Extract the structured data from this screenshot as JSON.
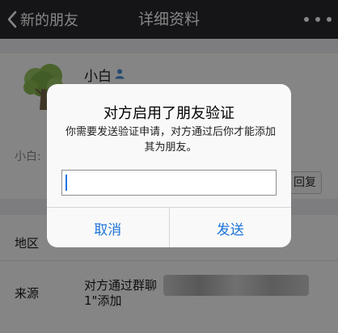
{
  "nav": {
    "back_label": "新的朋友",
    "title": "详细资料",
    "back_icon": "chevron-left-icon",
    "more_icon": "more-icon"
  },
  "profile": {
    "nickname": "小白",
    "gender_icon": "person-icon",
    "avatar_icon": "tree-icon",
    "remark": "小白: ",
    "reply_label": "回复"
  },
  "info": {
    "region_label": "地区",
    "source_label": "来源",
    "source_value_line1": "对方通过群聊",
    "source_value_line2": "1\"添加"
  },
  "dialog": {
    "title": "对方启用了朋友验证",
    "message": "你需要发送验证申请，对方通过后你才能添加其为朋友。",
    "input_value": "",
    "input_placeholder": "",
    "cancel_label": "取消",
    "send_label": "发送"
  },
  "colors": {
    "navbar": "#2a2a2e",
    "accent": "#1e74d8",
    "person_icon": "#4a90d9",
    "tree_foliage": "#8fbf55"
  }
}
